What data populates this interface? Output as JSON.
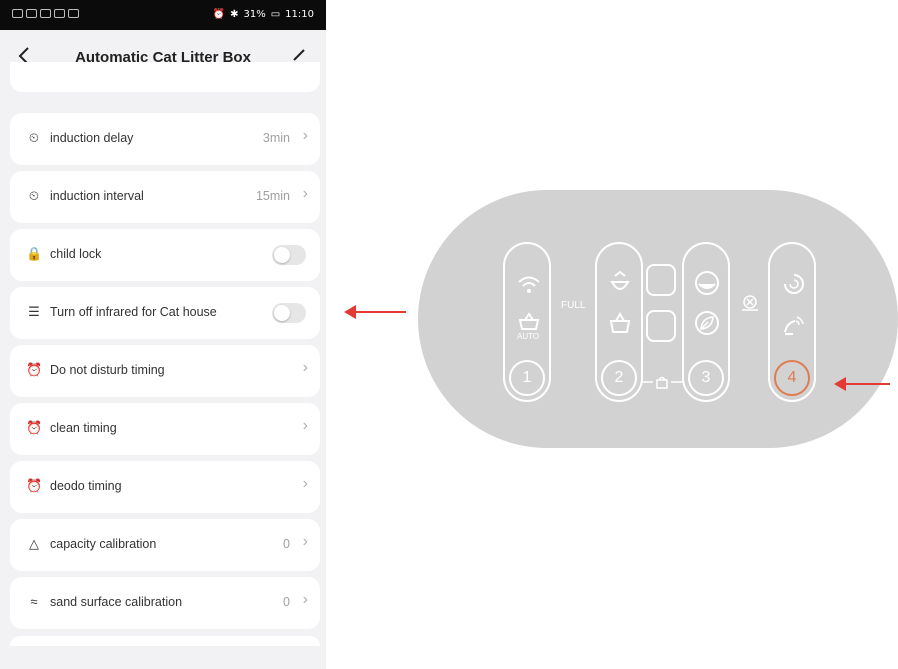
{
  "status_bar": {
    "right_text": "31%",
    "time": "11:10"
  },
  "nav": {
    "title": "Automatic Cat Litter Box"
  },
  "settings": [
    {
      "label": "induction delay",
      "value": "3min",
      "icon": "timer-icon",
      "type": "link"
    },
    {
      "label": "induction interval",
      "value": "15min",
      "icon": "timer-icon",
      "type": "link"
    },
    {
      "label": "child lock",
      "value": "",
      "icon": "lock-icon",
      "type": "toggle",
      "on": false
    },
    {
      "label": "Turn off infrared for Cat house",
      "value": "",
      "icon": "infrared-icon",
      "type": "toggle",
      "on": false
    },
    {
      "label": "Do not disturb timing",
      "value": "",
      "icon": "alarm-clock-icon",
      "type": "link"
    },
    {
      "label": "clean timing",
      "value": "",
      "icon": "alarm-clock-icon",
      "type": "link"
    },
    {
      "label": "deodo timing",
      "value": "",
      "icon": "alarm-clock-icon",
      "type": "link"
    },
    {
      "label": "capacity calibration",
      "value": "0",
      "icon": "capacity-icon",
      "type": "link"
    },
    {
      "label": "sand surface calibration",
      "value": "0",
      "icon": "wave-icon",
      "type": "link"
    }
  ],
  "device_panel": {
    "full_label": "FULL",
    "auto_label": "AUTO",
    "buttons": [
      "1",
      "2",
      "3",
      "4"
    ],
    "highlight_color": "#e07b4f",
    "accent_arrow_color": "#e53935"
  }
}
